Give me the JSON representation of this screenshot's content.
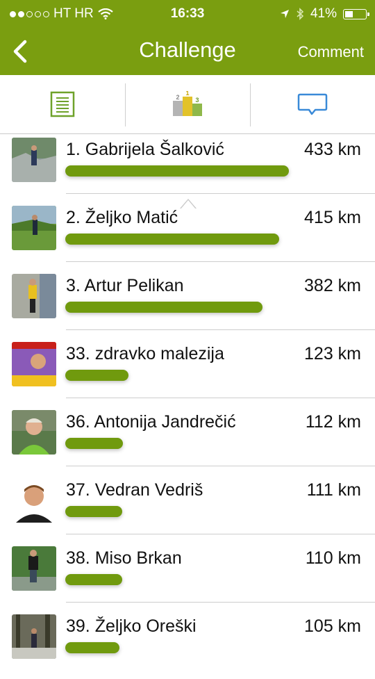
{
  "status_bar": {
    "carrier": "HT HR",
    "time": "16:33",
    "battery": "41%"
  },
  "navbar": {
    "title": "Challenge",
    "right_button": "Comment"
  },
  "tabs": [
    {
      "icon": "document-list-icon"
    },
    {
      "icon": "podium-icon",
      "podium_labels": [
        "2",
        "1",
        "3"
      ]
    },
    {
      "icon": "speech-bubble-icon"
    }
  ],
  "colors": {
    "header": "#7a9e10",
    "bar": "#709a0e"
  },
  "ranking": [
    {
      "name": "1. Gabrijela Šalković",
      "distance": "433 km",
      "progress": 1.0
    },
    {
      "name": "2. Željko Matić",
      "distance": "415 km",
      "progress": 0.958
    },
    {
      "name": "3. Artur Pelikan",
      "distance": "382 km",
      "progress": 0.882
    },
    {
      "name": "33. zdravko malezija",
      "distance": "123 km",
      "progress": 0.284
    },
    {
      "name": "36. Antonija Jandrečić",
      "distance": "112 km",
      "progress": 0.259
    },
    {
      "name": "37. Vedran Vedriš",
      "distance": "111 km",
      "progress": 0.256
    },
    {
      "name": "38. Miso Brkan",
      "distance": "110 km",
      "progress": 0.254
    },
    {
      "name": "39. Željko Oreški",
      "distance": "105 km",
      "progress": 0.242
    }
  ]
}
